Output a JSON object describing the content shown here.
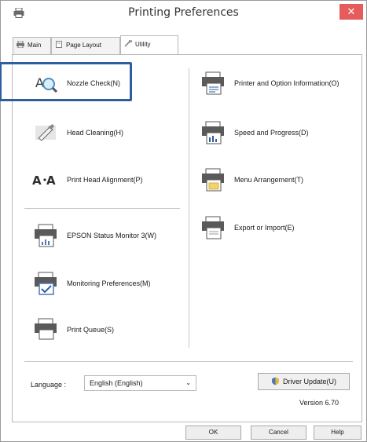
{
  "window": {
    "title": "Printing Preferences"
  },
  "tabs": [
    {
      "label": "Main",
      "icon": "printer-icon"
    },
    {
      "label": "Page Layout",
      "icon": "page-icon"
    },
    {
      "label": "Utility",
      "icon": "wrench-icon"
    }
  ],
  "left_items": [
    {
      "label": "Nozzle Check(N)",
      "icon": "nozzle-check-icon"
    },
    {
      "label": "Head Cleaning(H)",
      "icon": "head-cleaning-icon"
    },
    {
      "label": "Print Head Alignment(P)",
      "icon": "alignment-icon"
    },
    {
      "label": "EPSON Status Monitor 3(W)",
      "icon": "status-monitor-icon"
    },
    {
      "label": "Monitoring Preferences(M)",
      "icon": "monitoring-preferences-icon"
    },
    {
      "label": "Print Queue(S)",
      "icon": "print-queue-icon"
    }
  ],
  "right_items": [
    {
      "label": "Printer and Option Information(O)",
      "icon": "printer-info-icon"
    },
    {
      "label": "Speed and Progress(D)",
      "icon": "speed-progress-icon"
    },
    {
      "label": "Menu Arrangement(T)",
      "icon": "menu-arrangement-icon"
    },
    {
      "label": "Export or Import(E)",
      "icon": "export-import-icon"
    }
  ],
  "language": {
    "label": "Language :",
    "value": "English (English)"
  },
  "driver_update": {
    "label": "Driver Update(U)"
  },
  "version": "Version 6.70",
  "buttons": {
    "ok": "OK",
    "cancel": "Cancel",
    "help": "Help"
  },
  "colors": {
    "highlight_border": "#2e5e9e",
    "close_button": "#e65c5c"
  }
}
